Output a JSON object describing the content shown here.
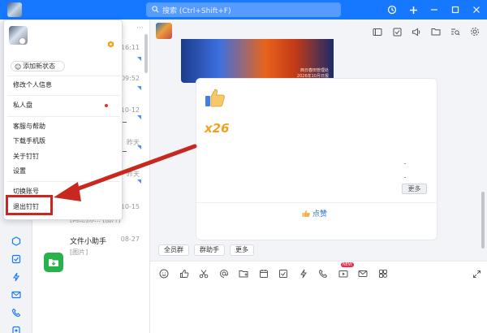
{
  "titlebar": {
    "search_placeholder": "搜索 (Ctrl+Shift+F)",
    "accent": "#1677ff"
  },
  "chatlist": {
    "times": [
      "16:11",
      "09:52",
      "10-12",
      "昨天",
      "昨天",
      "10-15",
      "08-27"
    ],
    "partial_item_sub": "[网络]你... [图片]",
    "file_helper": {
      "title": "文件小助手",
      "subtitle": "[图片]"
    }
  },
  "menu": {
    "status": "添加新状态",
    "items": {
      "edit_profile": "修改个人信息",
      "private_disk": "私人盘",
      "support": "客服与帮助",
      "download_mobile": "下载手机版",
      "about": "关于钉钉",
      "settings": "设置",
      "switch_account": "切换账号",
      "logout": "退出钉钉"
    }
  },
  "main": {
    "banner_text": [
      "西日春田管理处",
      "2026年10月日报"
    ],
    "like_count": "x26",
    "more_button": "更多",
    "like_button": "点赞",
    "chips": [
      "全员群",
      "群助手",
      "更多"
    ],
    "new_badge": "NEW"
  },
  "colors": {
    "highlight_red": "#c8281f",
    "green_icon": "#27b24a",
    "orange_count": "#f2a31b"
  }
}
